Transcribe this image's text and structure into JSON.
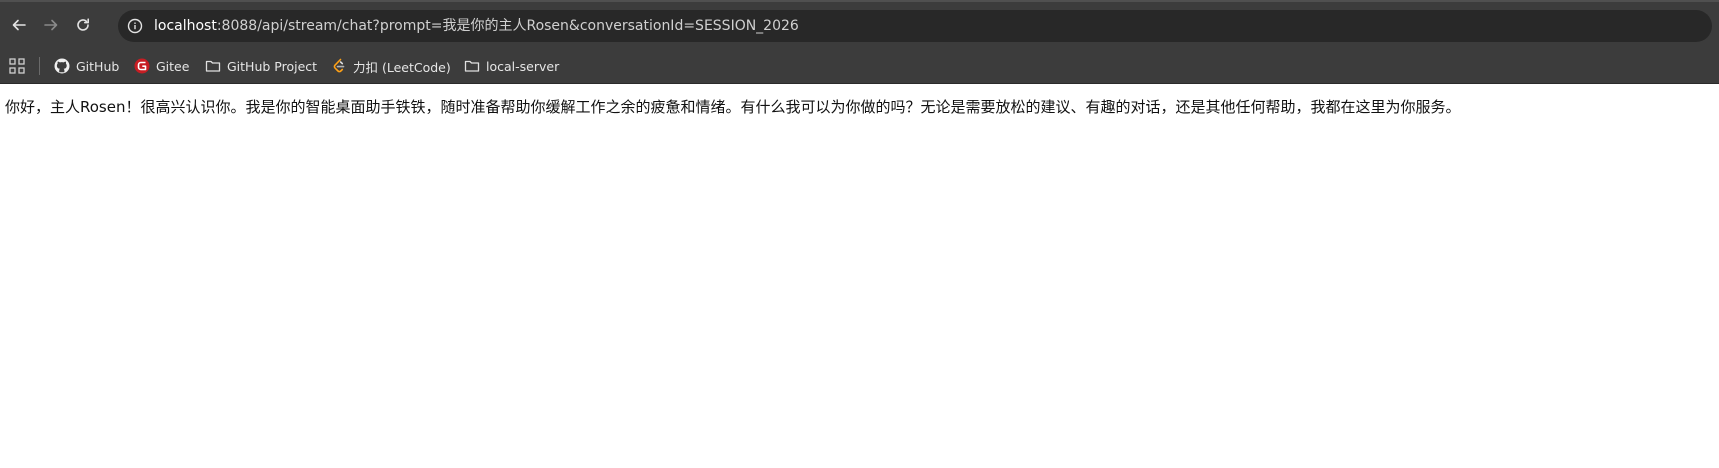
{
  "address_bar": {
    "host": "localhost",
    "path": ":8088/api/stream/chat?prompt=我是你的主人Rosen&conversationId=SESSION_2026"
  },
  "bookmarks": [
    {
      "label": "GitHub",
      "icon": "github-icon"
    },
    {
      "label": "Gitee",
      "icon": "gitee-icon"
    },
    {
      "label": "GitHub Project",
      "icon": "folder-icon"
    },
    {
      "label": "力扣 (LeetCode)",
      "icon": "leetcode-icon"
    },
    {
      "label": "local-server",
      "icon": "folder-icon"
    }
  ],
  "page": {
    "message": "你好，主人Rosen！很高兴认识你。我是你的智能桌面助手铁铁，随时准备帮助你缓解工作之余的疲惫和情绪。有什么我可以为你做的吗？无论是需要放松的建议、有趣的对话，还是其他任何帮助，我都在这里为你服务。"
  },
  "colors": {
    "toolbar_bg": "#3c3c3c",
    "omnibox_bg": "#282828",
    "gitee_red": "#c71d23",
    "leetcode_orange": "#ffa116"
  }
}
